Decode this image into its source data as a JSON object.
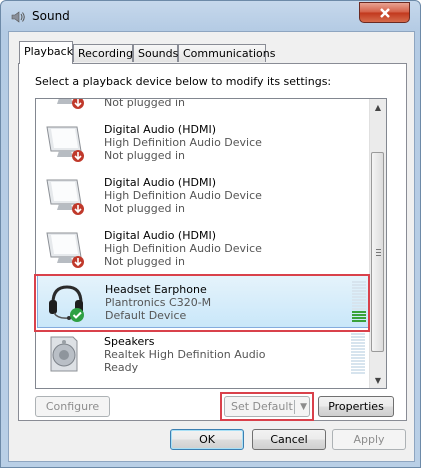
{
  "window": {
    "title": "Sound"
  },
  "tabs": [
    {
      "label": "Playback"
    },
    {
      "label": "Recording"
    },
    {
      "label": "Sounds"
    },
    {
      "label": "Communications"
    }
  ],
  "instruction": "Select a playback device below to modify its settings:",
  "devices": [
    {
      "name": "Digital Audio (HDMI)",
      "driver": "High Definition Audio Device",
      "status": "Not plugged in",
      "icon": "monitor-icon"
    },
    {
      "name": "Digital Audio (HDMI)",
      "driver": "High Definition Audio Device",
      "status": "Not plugged in",
      "icon": "monitor-icon"
    },
    {
      "name": "Digital Audio (HDMI)",
      "driver": "High Definition Audio Device",
      "status": "Not plugged in",
      "icon": "monitor-icon"
    },
    {
      "name": "Headset Earphone",
      "driver": "Plantronics C320-M",
      "status": "Default Device",
      "icon": "headset-icon",
      "selected": true
    },
    {
      "name": "Speakers",
      "driver": "Realtek High Definition Audio",
      "status": "Ready",
      "icon": "speaker-icon"
    }
  ],
  "buttons": {
    "configure": "Configure",
    "set_default": "Set Default",
    "properties": "Properties",
    "ok": "OK",
    "cancel": "Cancel",
    "apply": "Apply"
  },
  "colors": {
    "highlight_border": "#d9414b",
    "selection": "#c9e7f9",
    "meter_active": "#3aa23a"
  }
}
